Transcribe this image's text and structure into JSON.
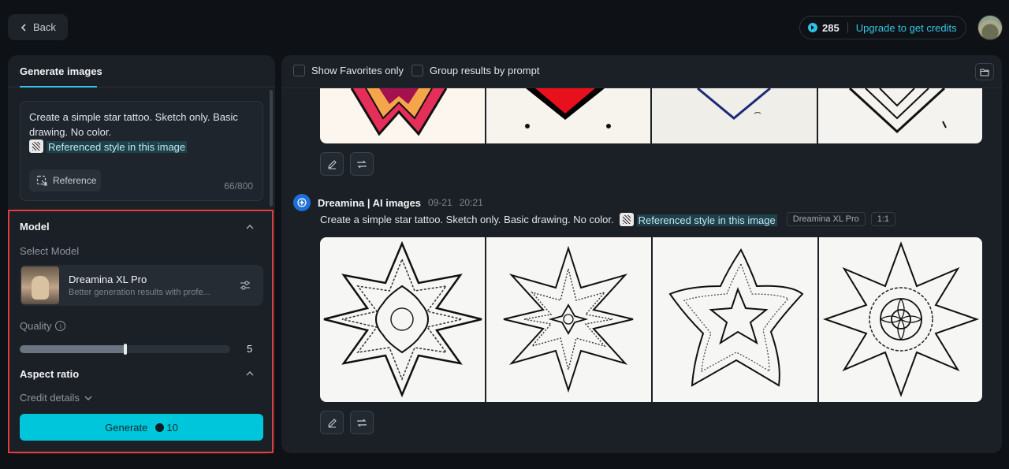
{
  "topbar": {
    "back_label": "Back",
    "credits_count": "285",
    "upgrade_label": "Upgrade to get credits"
  },
  "left": {
    "tab_label": "Generate images",
    "prompt_text": "Create a simple star tattoo. Sketch only. Basic drawing. No color.",
    "reference_chip": "Referenced style in this image",
    "reference_button": "Reference",
    "char_count": "66/800",
    "model_section": "Model",
    "select_model": "Select Model",
    "model_name": "Dreamina XL Pro",
    "model_desc": "Better generation results with profe...",
    "quality_label": "Quality",
    "quality_value": "5",
    "quality_fraction": 0.5,
    "aspect_ratio": "Aspect ratio",
    "credit_details": "Credit details",
    "generate_label": "Generate",
    "generate_cost": "10"
  },
  "right": {
    "show_favorites": "Show Favorites only",
    "group_results": "Group results by prompt",
    "brand_name": "Dreamina | AI images",
    "gen_date": "09-21",
    "gen_time": "20:21",
    "prompt_text": "Create a simple star tattoo. Sketch only. Basic drawing. No color.",
    "reference_chip": "Referenced style in this image",
    "model_tag": "Dreamina XL Pro",
    "ratio_tag": "1:1"
  },
  "colors": {
    "accent": "#00c6dc",
    "highlight": "#e43b3b",
    "panel": "#1b2026",
    "background": "#0e1116"
  }
}
